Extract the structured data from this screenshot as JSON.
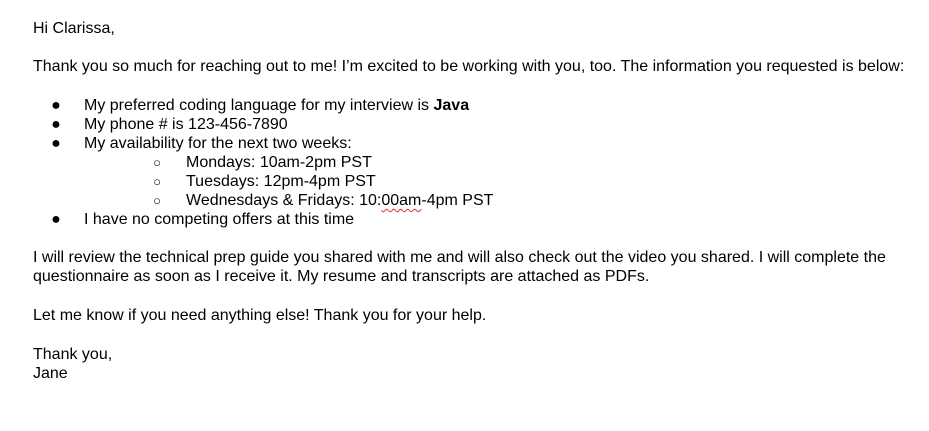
{
  "email": {
    "greeting": "Hi Clarissa,",
    "intro": "Thank you so much for reaching out to me! I’m excited to be working with you, too. The information you requested is below:",
    "bullets": {
      "coding_language_prefix": "My preferred coding language for my interview is ",
      "coding_language": "Java",
      "phone": "My phone # is 123-456-7890",
      "availability": "My availability for the next two weeks:",
      "schedule": {
        "mondays": "Mondays: 10am-2pm PST",
        "tuesdays": "Tuesdays: 12pm-4pm PST",
        "wed_fri_prefix": "Wednesdays & Fridays: 10:",
        "wed_fri_flagged": "00am",
        "wed_fri_suffix": "-4pm PST"
      },
      "offers": "I have no competing offers at this time"
    },
    "body": "I will review the technical prep guide you shared with me and will also check out the video you shared. I will complete the questionnaire as soon as I receive it. My resume and transcripts are attached as PDFs.",
    "closing_note": "Let me know if you need anything else! Thank you for your help.",
    "signoff": "Thank you,",
    "signature": "Jane"
  },
  "glyphs": {
    "bullet_filled": "●",
    "bullet_hollow": "○"
  }
}
